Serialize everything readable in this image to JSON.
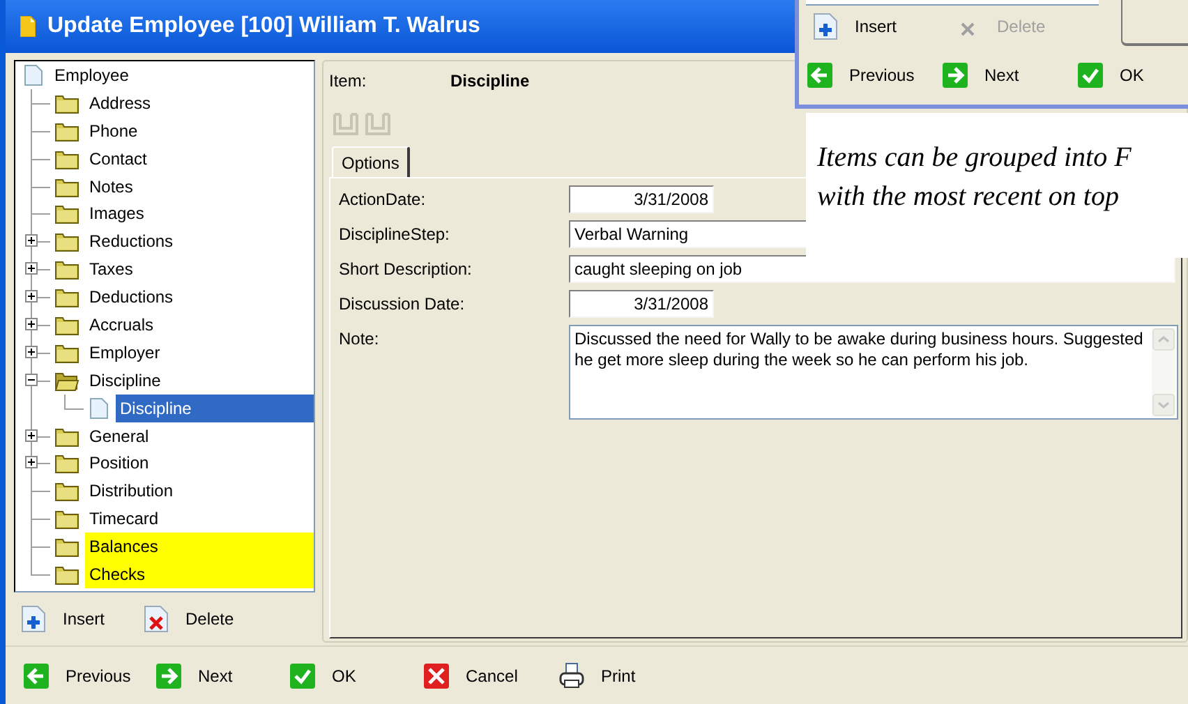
{
  "window": {
    "title": "Update Employee [100] William T. Walrus"
  },
  "tree": {
    "label": "Employee",
    "kind": "item",
    "highlighted": false,
    "selected": false,
    "children": [
      {
        "label": "Address",
        "kind": "folder",
        "highlighted": false,
        "selected": false
      },
      {
        "label": "Phone",
        "kind": "folder",
        "highlighted": false,
        "selected": false
      },
      {
        "label": "Contact",
        "kind": "folder",
        "highlighted": false,
        "selected": false
      },
      {
        "label": "Notes",
        "kind": "folder",
        "highlighted": false,
        "selected": false
      },
      {
        "label": "Images",
        "kind": "folder",
        "highlighted": false,
        "selected": false
      },
      {
        "label": "Reductions",
        "kind": "group",
        "expanded": false,
        "highlighted": false,
        "selected": false
      },
      {
        "label": "Taxes",
        "kind": "group",
        "expanded": false,
        "highlighted": false,
        "selected": false
      },
      {
        "label": "Deductions",
        "kind": "group",
        "expanded": false,
        "highlighted": false,
        "selected": false
      },
      {
        "label": "Accruals",
        "kind": "group",
        "expanded": false,
        "highlighted": false,
        "selected": false
      },
      {
        "label": "Employer",
        "kind": "group",
        "expanded": false,
        "highlighted": false,
        "selected": false
      },
      {
        "label": "Discipline",
        "kind": "group",
        "expanded": true,
        "highlighted": false,
        "selected": false,
        "children": [
          {
            "label": "Discipline",
            "kind": "item",
            "highlighted": false,
            "selected": true
          }
        ]
      },
      {
        "label": "General",
        "kind": "group",
        "expanded": false,
        "highlighted": false,
        "selected": false
      },
      {
        "label": "Position",
        "kind": "group",
        "expanded": false,
        "highlighted": false,
        "selected": false
      },
      {
        "label": "Distribution",
        "kind": "folder",
        "highlighted": false,
        "selected": false
      },
      {
        "label": "Timecard",
        "kind": "folder",
        "highlighted": false,
        "selected": false
      },
      {
        "label": "Balances",
        "kind": "folder",
        "highlighted": true,
        "selected": false
      },
      {
        "label": "Checks",
        "kind": "folder",
        "highlighted": true,
        "selected": false
      }
    ]
  },
  "tree_buttons": [
    {
      "label": "Insert",
      "kind": "insert",
      "disabled": false
    },
    {
      "label": "Delete",
      "kind": "delete",
      "disabled": false
    }
  ],
  "detail": {
    "item_label": "Item:",
    "item_value": "Discipline",
    "tabs": [
      {
        "label": "Options",
        "selected": true
      }
    ],
    "fields": [
      {
        "label": "ActionDate:",
        "value": "3/31/2008",
        "kind": "date"
      },
      {
        "label": "DisciplineStep:",
        "value": "Verbal Warning",
        "kind": "partial"
      },
      {
        "label": "Short Description:",
        "value": "caught sleeping on job",
        "kind": "text"
      },
      {
        "label": "Discussion Date:",
        "value": "3/31/2008",
        "kind": "date"
      },
      {
        "label": "Note:",
        "value": "Discussed the need for Wally to be awake during business hours.  Suggested he get more sleep during the week so he can perform his job.",
        "kind": "memo"
      }
    ]
  },
  "buttons": [
    {
      "label": "Previous",
      "kind": "previous"
    },
    {
      "label": "Next",
      "kind": "next"
    },
    {
      "label": "OK",
      "kind": "ok"
    },
    {
      "label": "Cancel",
      "kind": "cancel"
    },
    {
      "label": "Print",
      "kind": "print"
    }
  ],
  "inset_window": {
    "buttons": [
      {
        "label": "Insert",
        "kind": "insert",
        "disabled": false
      },
      {
        "label": "Delete",
        "kind": "delete",
        "disabled": true
      }
    ],
    "nav": [
      {
        "label": "Previous",
        "kind": "previous"
      },
      {
        "label": "Next",
        "kind": "next"
      },
      {
        "label": "OK",
        "kind": "ok"
      }
    ]
  },
  "caption": {
    "lines": [
      "Items can be grouped into F",
      "with the most recent on top"
    ]
  }
}
